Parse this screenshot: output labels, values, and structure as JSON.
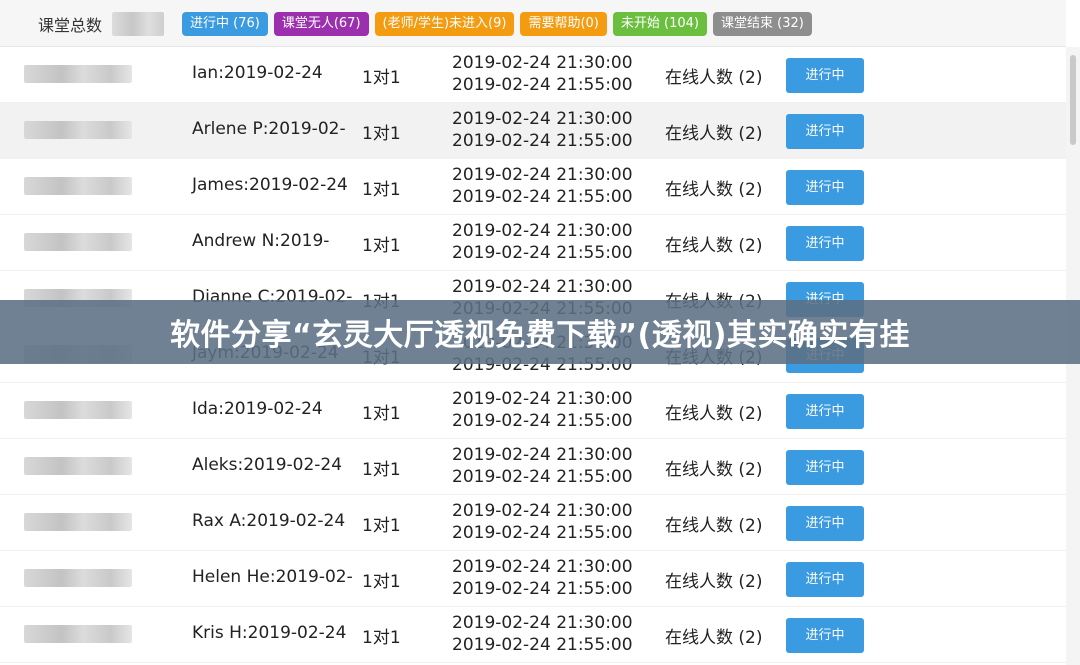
{
  "header": {
    "label": "课堂总数",
    "count_blurred": true
  },
  "filters": [
    {
      "label": "进行中 (76)",
      "color": "#3a9be0"
    },
    {
      "label": "课堂无人(67)",
      "color": "#9b2fae"
    },
    {
      "label": "(老师/学生)未进入(9)",
      "color": "#f39c12"
    },
    {
      "label": "需要帮助(0)",
      "color": "#f39c12"
    },
    {
      "label": "未开始 (104)",
      "color": "#6bbf3e"
    },
    {
      "label": "课堂结束 (32)",
      "color": "#8e8e8e"
    }
  ],
  "rows": [
    {
      "course": "Ian:2019-02-24",
      "type": "1对1",
      "start": "2019-02-24 21:30:00",
      "end": "2019-02-24 21:55:00",
      "online": "在线人数 (2)",
      "status": "进行中"
    },
    {
      "course": "Arlene P:2019-02-",
      "type": "1对1",
      "start": "2019-02-24 21:30:00",
      "end": "2019-02-24 21:55:00",
      "online": "在线人数 (2)",
      "status": "进行中"
    },
    {
      "course": "James:2019-02-24",
      "type": "1对1",
      "start": "2019-02-24 21:30:00",
      "end": "2019-02-24 21:55:00",
      "online": "在线人数 (2)",
      "status": "进行中"
    },
    {
      "course": "Andrew N:2019-",
      "type": "1对1",
      "start": "2019-02-24 21:30:00",
      "end": "2019-02-24 21:55:00",
      "online": "在线人数 (2)",
      "status": "进行中"
    },
    {
      "course": "Dianne C:2019-02-",
      "type": "1对1",
      "start": "2019-02-24 21:30:00",
      "end": "2019-02-24 21:55:00",
      "online": "在线人数 (2)",
      "status": "进行中"
    },
    {
      "course": "Jaym:2019-02-24",
      "type": "1对1",
      "start": "2019-02-24 21:30:00",
      "end": "2019-02-24 21:55:00",
      "online": "在线人数 (2)",
      "status": "进行中"
    },
    {
      "course": "Ida:2019-02-24",
      "type": "1对1",
      "start": "2019-02-24 21:30:00",
      "end": "2019-02-24 21:55:00",
      "online": "在线人数 (2)",
      "status": "进行中"
    },
    {
      "course": "Aleks:2019-02-24",
      "type": "1对1",
      "start": "2019-02-24 21:30:00",
      "end": "2019-02-24 21:55:00",
      "online": "在线人数 (2)",
      "status": "进行中"
    },
    {
      "course": "Rax A:2019-02-24",
      "type": "1对1",
      "start": "2019-02-24 21:30:00",
      "end": "2019-02-24 21:55:00",
      "online": "在线人数 (2)",
      "status": "进行中"
    },
    {
      "course": "Helen He:2019-02-",
      "type": "1对1",
      "start": "2019-02-24 21:30:00",
      "end": "2019-02-24 21:55:00",
      "online": "在线人数 (2)",
      "status": "进行中"
    },
    {
      "course": "Kris H:2019-02-24",
      "type": "1对1",
      "start": "2019-02-24 21:30:00",
      "end": "2019-02-24 21:55:00",
      "online": "在线人数 (2)",
      "status": "进行中"
    }
  ],
  "banner": {
    "text": "软件分享“玄灵大厅透视免费下载”(透视)其实确实有挂"
  }
}
